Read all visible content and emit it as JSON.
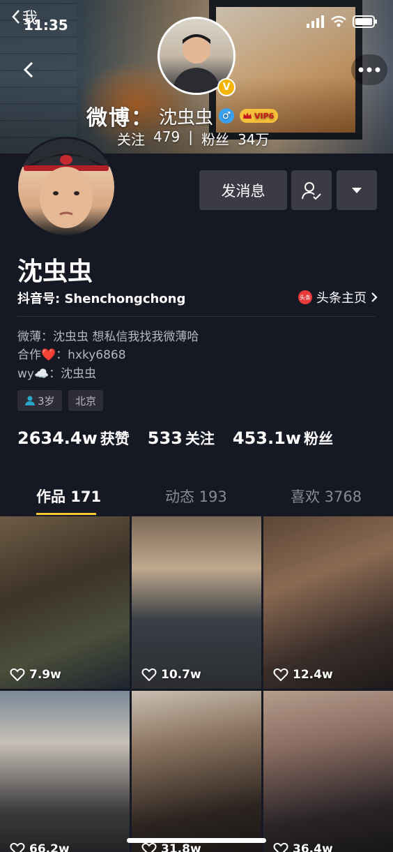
{
  "status_bar": {
    "time": "11:35",
    "back_label": "我"
  },
  "banner": {
    "weibo_brand": "微博：",
    "weibo_name": "沈虫虫",
    "gender_symbol": "♂",
    "vip_label": "VIP6",
    "follow_label": "关注",
    "follow_count": "479",
    "separator": "|",
    "fans_label": "粉丝",
    "fans_count": "34万",
    "verify_symbol": "V"
  },
  "profile": {
    "name": "沈虫虫",
    "douyin_id": "抖音号: Shenchongchong",
    "toutiao_icon_text": "头条",
    "toutiao_link": "头条主页",
    "bio": [
      "微薄：沈虫虫 想私信我找我微薄哈",
      "合作❤️：hxky6868",
      "wy☁️：沈虫虫"
    ],
    "tags": {
      "age": "3岁",
      "city": "北京"
    }
  },
  "actions": {
    "message_label": "发消息"
  },
  "stats": [
    {
      "num": "2634.4w",
      "label": "获赞"
    },
    {
      "num": "533",
      "label": "关注"
    },
    {
      "num": "453.1w",
      "label": "粉丝"
    }
  ],
  "tabs": [
    {
      "label": "作品 171",
      "active": true
    },
    {
      "label": "动态 193",
      "active": false
    },
    {
      "label": "喜欢 3768",
      "active": false
    }
  ],
  "videos": [
    {
      "likes": "7.9w"
    },
    {
      "likes": "10.7w"
    },
    {
      "likes": "12.4w"
    },
    {
      "likes": "66.2w"
    },
    {
      "likes": "31.8w"
    },
    {
      "likes": "36.4w"
    }
  ],
  "colors": {
    "background": "#161823",
    "accent": "#f8c630",
    "button": "#3a3b45"
  }
}
